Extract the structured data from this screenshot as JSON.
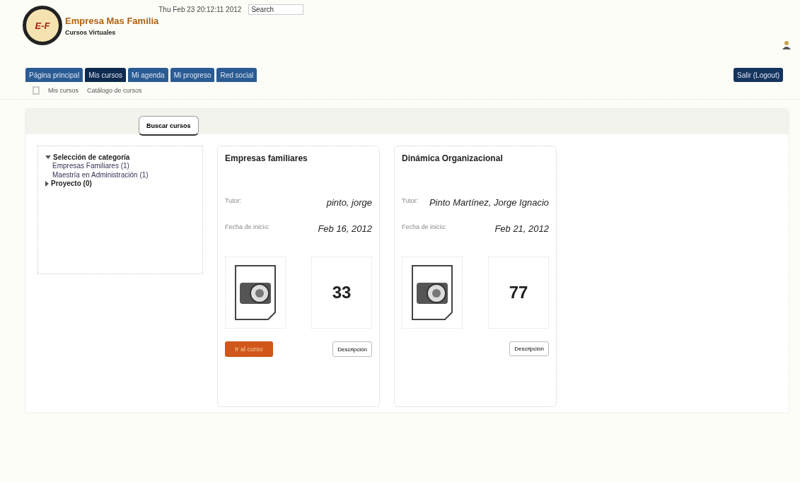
{
  "header": {
    "logo": "E-F",
    "company": "Empresa Mas Familia",
    "tagline": "Cursos Virtuales",
    "datetime": "Thu Feb 23 20:12:11 2012",
    "search": {
      "placeholder": "Search"
    }
  },
  "tabs": [
    {
      "label": "Página principal",
      "selected": false
    },
    {
      "label": "Mis cursos",
      "selected": true
    },
    {
      "label": "Mi agenda",
      "selected": false
    },
    {
      "label": "Mi progreso",
      "selected": false
    },
    {
      "label": "Red social",
      "selected": false
    }
  ],
  "logout": "Salir (Logout)",
  "breadcrumb": [
    "Mis cursos",
    "Catálogo de cursos"
  ],
  "search_courses": "Buscar cursos",
  "categories": [
    {
      "label": "Selección de categoría",
      "expanded": true,
      "children": [
        {
          "label": "Empresas Familiares (1)"
        },
        {
          "label": "Maestría en Administración (1)"
        }
      ]
    },
    {
      "label": "Proyecto (0)",
      "expanded": false
    }
  ],
  "courses": [
    {
      "title": "Empresas familiares",
      "tutor_label": "Tutor:",
      "tutor": "pinto, jorge",
      "date_label": "Fecha de inicio:",
      "date": "Feb 16, 2012",
      "count": "33",
      "enter": "Ir al curso",
      "description": "Descripción"
    },
    {
      "title": "Dinámica Organizacional",
      "tutor_label": "Tutor:",
      "tutor": "Pinto Martínez, Jorge Ignacio",
      "date_label": "Fecha de inicio:",
      "date": "Feb 21, 2012",
      "count": "77",
      "description": "Descripción"
    }
  ]
}
